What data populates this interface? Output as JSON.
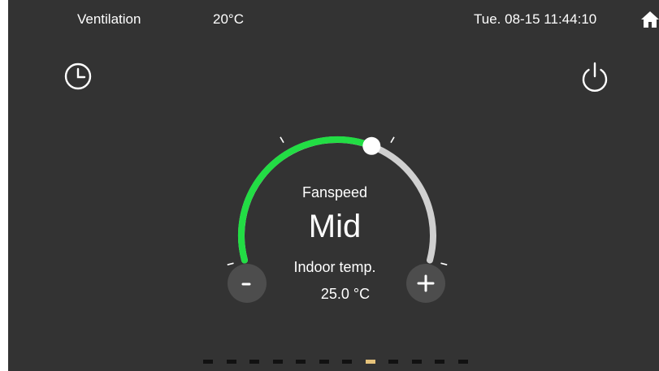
{
  "status_bar": {
    "mode": "Ventilation",
    "outdoor_temp": "20°C",
    "datetime": "Tue. 08-15 11:44:10"
  },
  "icons": {
    "home": "home-icon",
    "timer": "clock-icon",
    "power": "power-icon"
  },
  "fan_dial": {
    "title": "Fanspeed",
    "value": "Mid",
    "level_fraction": 0.6,
    "active_color": "#22dd44",
    "inactive_color": "#d0d0d0"
  },
  "indoor": {
    "label": "Indoor temp.",
    "value": "25.0 °C"
  },
  "controls": {
    "minus_label": "-",
    "plus_label": "+"
  },
  "pager": {
    "page_count": 12,
    "active_index": 7,
    "active_color": "#e5c27a"
  }
}
